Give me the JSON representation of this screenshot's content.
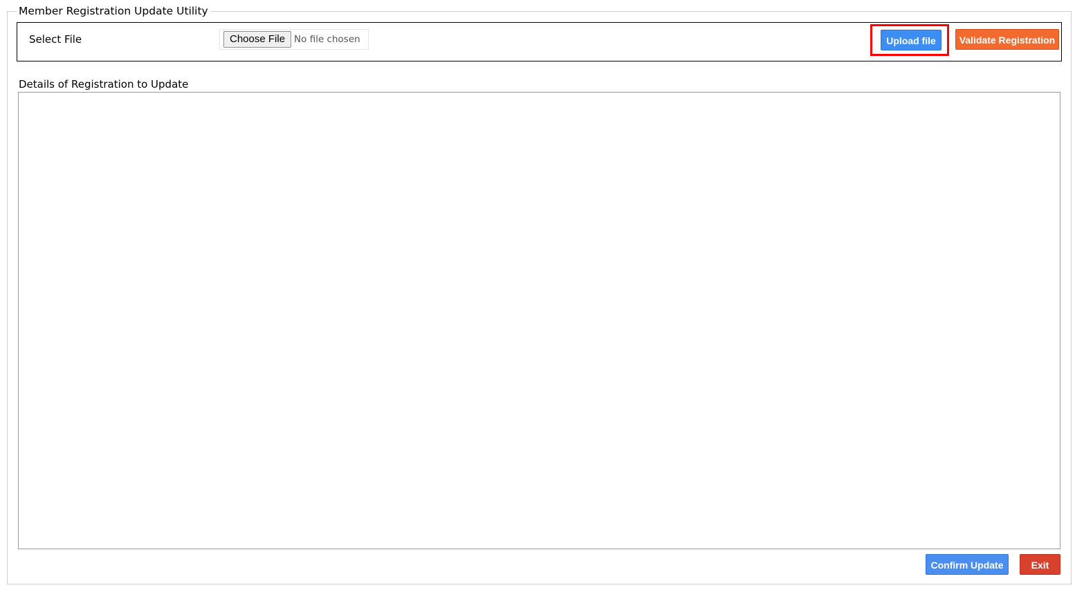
{
  "utility": {
    "title": "Member Registration Update Utility"
  },
  "file_select": {
    "label": "Select File",
    "choose_button": "Choose File",
    "status": "No file chosen"
  },
  "actions": {
    "upload_label": "Upload file",
    "validate_label": "Validate Registration"
  },
  "details": {
    "label": "Details of Registration to Update",
    "content": ""
  },
  "footer": {
    "confirm_label": "Confirm Update",
    "exit_label": "Exit"
  },
  "colors": {
    "upload": "#3c8ef3",
    "validate": "#f26a2e",
    "confirm": "#4a8ff0",
    "exit": "#d9412f",
    "highlight": "#ff0000"
  }
}
